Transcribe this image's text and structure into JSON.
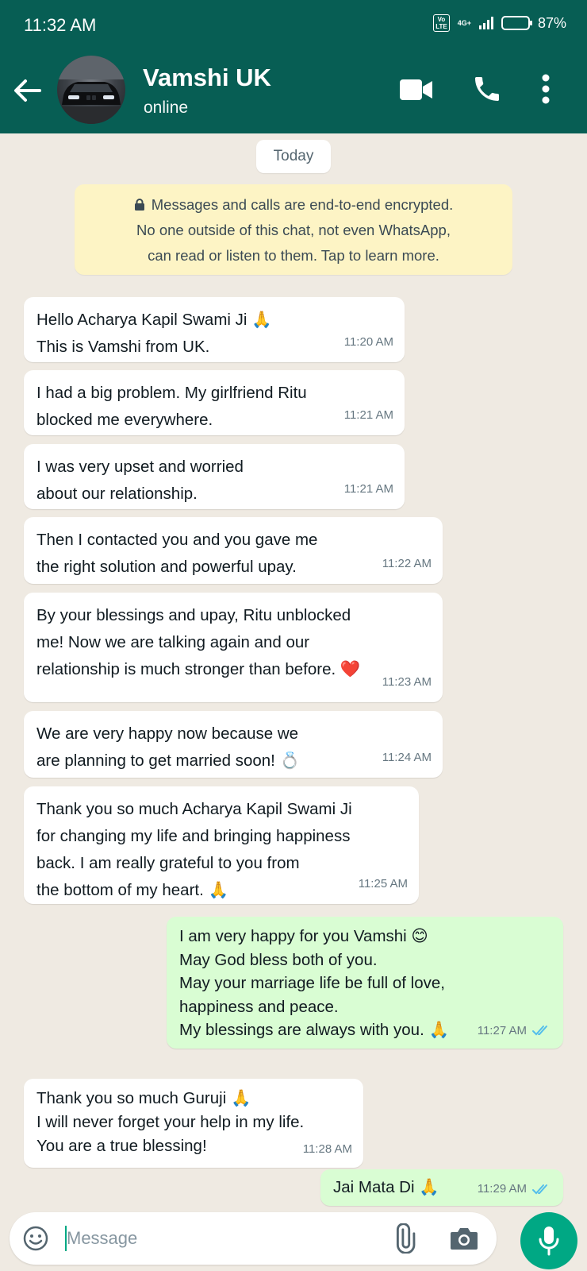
{
  "status_bar": {
    "time": "11:32 AM",
    "volte_label": "Vo\nLTE",
    "network": "4G+",
    "battery": "87%",
    "battery_level": 0.87
  },
  "header": {
    "contact_name": "Vamshi UK",
    "presence": "online",
    "back_icon": "arrow-left-icon",
    "video_icon": "video-call-icon",
    "call_icon": "phone-icon",
    "menu_icon": "more-vert-icon"
  },
  "chat": {
    "date_chip": "Today",
    "encryption_note": "Messages and calls are end-to-end encrypted.\nNo one outside of this chat, not even WhatsApp,\ncan read or listen to them. Tap to learn more.",
    "messages": [
      {
        "direction": "in",
        "text": "Hello Acharya Kapil Swami Ji 🙏\nThis is Vamshi from UK.",
        "time": "11:20 AM"
      },
      {
        "direction": "in",
        "text": "I had a big problem. My girlfriend Ritu\nblocked me everywhere.",
        "time": "11:21 AM"
      },
      {
        "direction": "in",
        "text": "I was very upset and worried\nabout our relationship.",
        "time": "11:21 AM"
      },
      {
        "direction": "in",
        "text": "Then I contacted you and you gave me\nthe right solution and powerful upay.",
        "time": "11:22 AM"
      },
      {
        "direction": "in",
        "text": "By your blessings and upay, Ritu unblocked\nme! Now we are talking again and our\nrelationship is much stronger than before. ❤️",
        "time": "11:23 AM"
      },
      {
        "direction": "in",
        "text": "We are very happy now because we\nare planning to get married soon! 💍",
        "time": "11:24 AM"
      },
      {
        "direction": "in",
        "text": "Thank you so much Acharya Kapil Swami Ji\nfor changing my life and bringing happiness\nback. I am really grateful to you from\nthe bottom of my heart. 🙏",
        "time": "11:25 AM"
      },
      {
        "direction": "out",
        "text": "I am very happy for you Vamshi 😊\nMay God bless both of you.\nMay your marriage life be full of love,\nhappiness and peace.\nMy blessings are always with you. 🙏",
        "time": "11:27 AM",
        "status": "read"
      },
      {
        "direction": "in",
        "text": "Thank you so much Guruji 🙏\nI will never forget your help in my life.\nYou are a true blessing!",
        "time": "11:28 AM"
      },
      {
        "direction": "out",
        "text": "Jai Mata Di 🙏",
        "time": "11:29 AM",
        "status": "read"
      }
    ]
  },
  "composer": {
    "placeholder": "Message",
    "emoji_icon": "emoji-icon",
    "attach_icon": "paperclip-icon",
    "camera_icon": "camera-icon",
    "mic_icon": "microphone-icon"
  },
  "colors": {
    "header": "#075e54",
    "chat_background": "#efeae2",
    "outgoing_bubble": "#d9fdd3",
    "incoming_bubble": "#ffffff",
    "encryption_note": "#fdf4c5",
    "read_ticks": "#53bdeb",
    "accent": "#00a884"
  }
}
